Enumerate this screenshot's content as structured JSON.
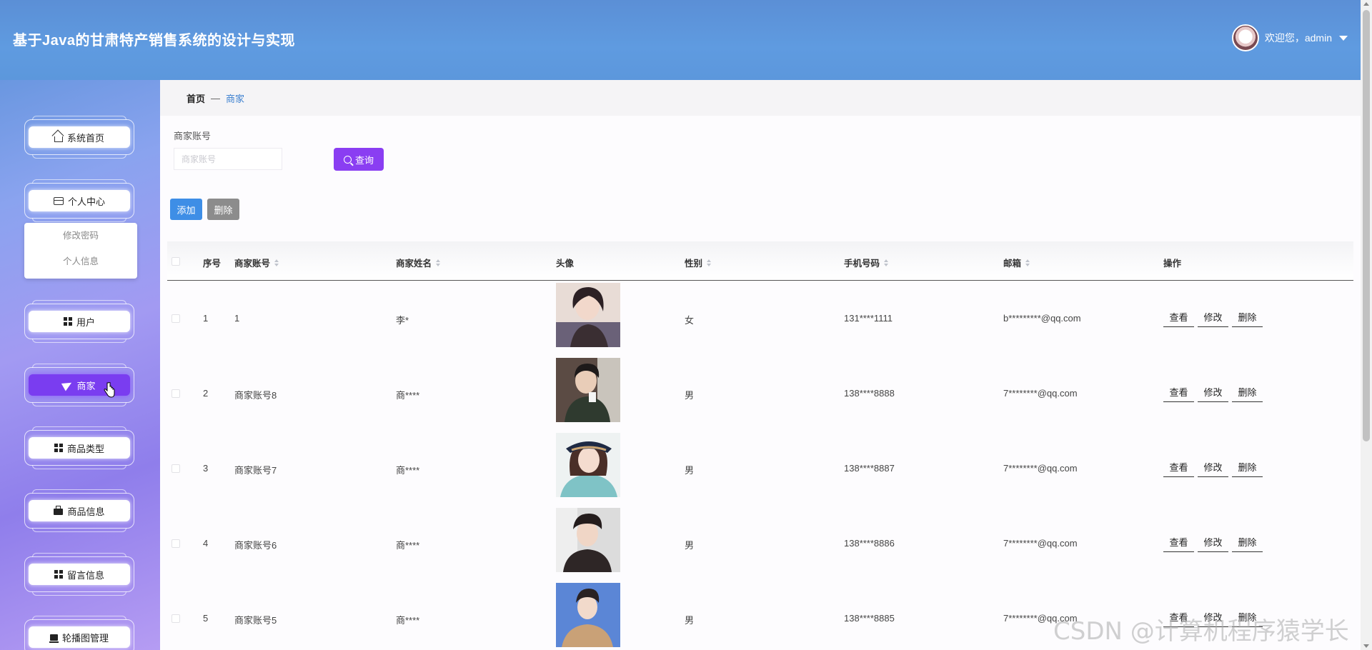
{
  "header": {
    "title": "基于Java的甘肃特产销售系统的设计与实现",
    "welcome": "欢迎您，admin"
  },
  "sidebar": {
    "items": [
      {
        "label": "系统首页",
        "icon": "home-icon"
      },
      {
        "label": "个人中心",
        "icon": "card-icon"
      },
      {
        "label": "用户",
        "icon": "grid-icon"
      },
      {
        "label": "商家",
        "icon": "send-icon",
        "active": true
      },
      {
        "label": "商品类型",
        "icon": "grid-icon"
      },
      {
        "label": "商品信息",
        "icon": "briefcase-icon"
      },
      {
        "label": "留言信息",
        "icon": "grid-icon"
      },
      {
        "label": "轮播图管理",
        "icon": "slides-icon"
      }
    ],
    "submenu": [
      "修改密码",
      "个人信息"
    ],
    "active_color": "#7a3df0"
  },
  "breadcrumb": {
    "home": "首页",
    "separator": "—",
    "current": "商家"
  },
  "search": {
    "label": "商家账号",
    "placeholder": "商家账号",
    "query_label": "查询"
  },
  "actions": {
    "add_label": "添加",
    "delete_label": "删除"
  },
  "table": {
    "headers": {
      "index": "序号",
      "account": "商家账号",
      "name": "商家姓名",
      "avatar": "头像",
      "gender": "性别",
      "phone": "手机号码",
      "email": "邮箱",
      "ops": "操作"
    },
    "op_labels": {
      "view": "查看",
      "edit": "修改",
      "delete": "删除"
    },
    "rows": [
      {
        "index": "1",
        "account": "1",
        "name": "李*",
        "gender": "女",
        "phone": "131****1111",
        "email": "b*********@qq.com"
      },
      {
        "index": "2",
        "account": "商家账号8",
        "name": "商****",
        "gender": "男",
        "phone": "138****8888",
        "email": "7********@qq.com"
      },
      {
        "index": "3",
        "account": "商家账号7",
        "name": "商****",
        "gender": "男",
        "phone": "138****8887",
        "email": "7********@qq.com"
      },
      {
        "index": "4",
        "account": "商家账号6",
        "name": "商****",
        "gender": "男",
        "phone": "138****8886",
        "email": "7********@qq.com"
      },
      {
        "index": "5",
        "account": "商家账号5",
        "name": "商****",
        "gender": "男",
        "phone": "138****8885",
        "email": "7********@qq.com"
      }
    ]
  },
  "watermark": "CSDN @计算机程序猿学长",
  "colors": {
    "header": "#5f9be0",
    "primary_button": "#8a3ef2",
    "add_button": "#3e8ee6",
    "delete_button": "#8c8c8c",
    "breadcrumb_current": "#3b7fcf"
  }
}
